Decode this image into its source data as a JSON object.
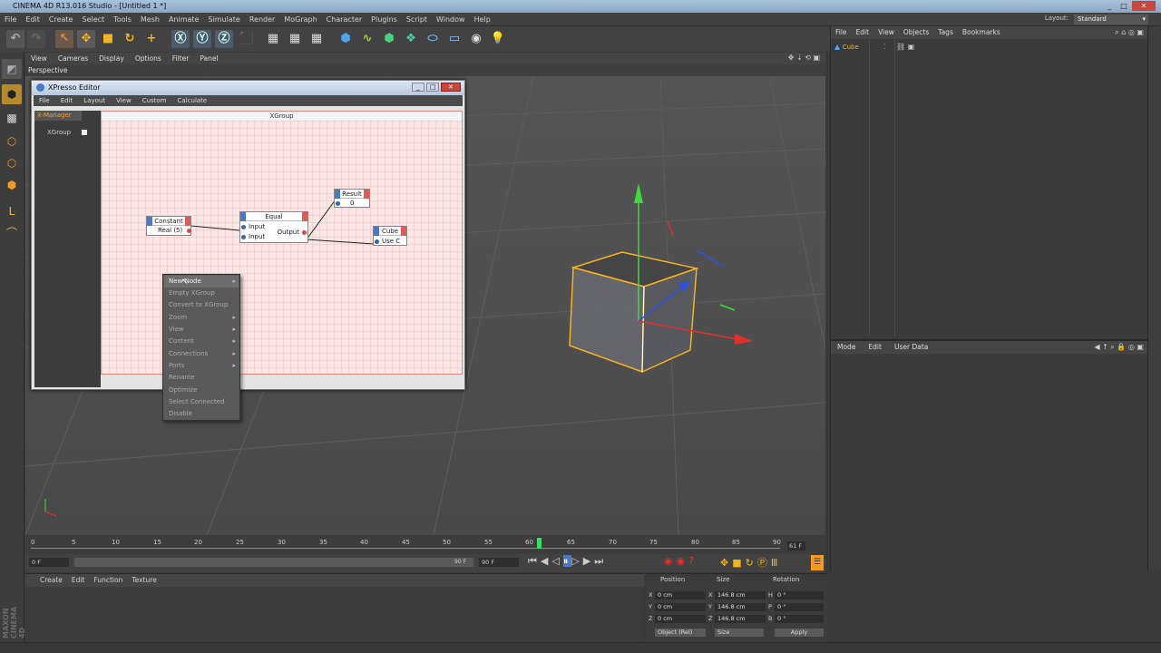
{
  "window": {
    "title": "CINEMA 4D R13.016 Studio - [Untitled 1 *]"
  },
  "menubar": [
    "File",
    "Edit",
    "Create",
    "Select",
    "Tools",
    "Mesh",
    "Animate",
    "Simulate",
    "Render",
    "MoGraph",
    "Character",
    "Plugins",
    "Script",
    "Window",
    "Help"
  ],
  "layout": {
    "label": "Layout:",
    "value": "Standard"
  },
  "viewport": {
    "menu": [
      "View",
      "Cameras",
      "Display",
      "Options",
      "Filter",
      "Panel"
    ],
    "label": "Perspective"
  },
  "xpresso": {
    "title": "XPresso Editor",
    "menu": [
      "File",
      "Edit",
      "Layout",
      "View",
      "Custom",
      "Calculate"
    ],
    "xmanager": "X-Manager",
    "tree_item": "XGroup",
    "canvas_title": "XGroup",
    "nodes": {
      "constant": {
        "title": "Constant",
        "port": "Real (5)"
      },
      "equal": {
        "title": "Equal",
        "in1": "Input",
        "in2": "Input",
        "out": "Output"
      },
      "result": {
        "title": "Result",
        "value": "0"
      },
      "cube": {
        "title": "Cube",
        "port": "Use C"
      }
    }
  },
  "context_menu": [
    "New Node",
    "Empty XGroup",
    "Convert to XGroup",
    "Zoom",
    "View",
    "Content",
    "Connections",
    "Ports",
    "Rename",
    "Optimize",
    "Select Connected",
    "Disable"
  ],
  "objects": {
    "menu": [
      "File",
      "Edit",
      "View",
      "Objects",
      "Tags",
      "Bookmarks"
    ],
    "item": "Cube"
  },
  "attributes": {
    "menu": [
      "Mode",
      "Edit",
      "User Data"
    ]
  },
  "timeline": {
    "ticks": [
      "0",
      "5",
      "10",
      "15",
      "20",
      "25",
      "30",
      "35",
      "40",
      "45",
      "50",
      "55",
      "60",
      "65",
      "70",
      "75",
      "80",
      "85",
      "90"
    ],
    "current_frame": "61 F",
    "current": 61
  },
  "transport": {
    "start": "0 F",
    "end_field": "90 F",
    "range_end": "90 F"
  },
  "materials": {
    "menu": [
      "Create",
      "Edit",
      "Function",
      "Texture"
    ]
  },
  "coords": {
    "headers": [
      "Position",
      "Size",
      "Rotation"
    ],
    "rows": [
      {
        "axis": "X",
        "pos": "0 cm",
        "size": "146.8 cm",
        "rot_axis": "H",
        "rot": "0 °"
      },
      {
        "axis": "Y",
        "pos": "0 cm",
        "size": "146.8 cm",
        "rot_axis": "P",
        "rot": "0 °"
      },
      {
        "axis": "Z",
        "pos": "0 cm",
        "size": "146.8 cm",
        "rot_axis": "B",
        "rot": "0 °"
      }
    ],
    "mode": "Object (Rel)",
    "size_mode": "Size",
    "apply": "Apply"
  },
  "brand": {
    "line1": "MAXON",
    "line2": "CINEMA 4D"
  }
}
